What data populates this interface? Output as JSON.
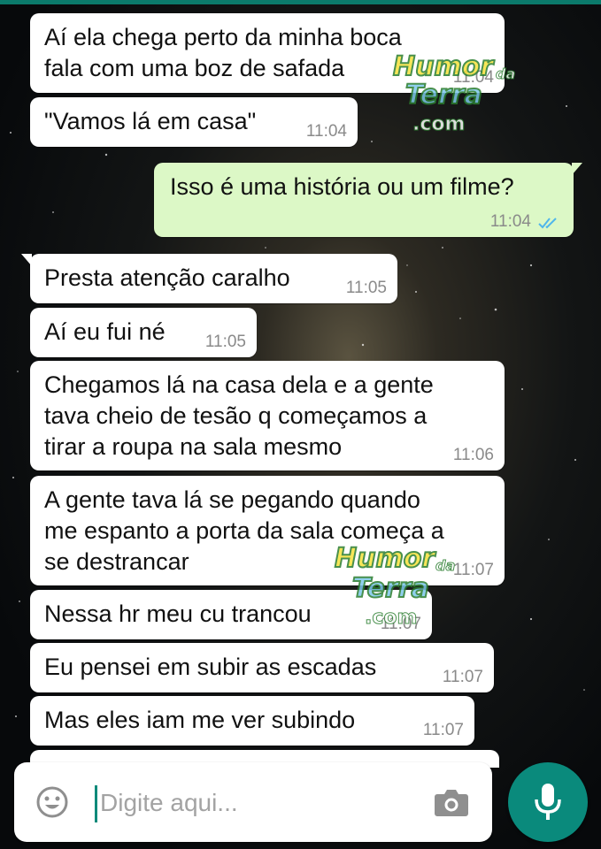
{
  "colors": {
    "header_accent": "#0b7a6b",
    "incoming_bubble": "#ffffff",
    "outgoing_bubble": "#dcf8c6",
    "read_ticks": "#4fb6ec",
    "mic_button": "#0a8a7c"
  },
  "messages": [
    {
      "direction": "incoming",
      "text": "Aí ela chega perto da minha boca\nfala com uma boz de safada",
      "time": "11:04"
    },
    {
      "direction": "incoming",
      "text": "\"Vamos lá em casa\"",
      "time": "11:04"
    },
    {
      "direction": "outgoing",
      "text": "Isso é uma história ou um filme?",
      "time": "11:04",
      "status": "read-double-check-icon"
    },
    {
      "direction": "incoming",
      "text": "Presta atenção caralho",
      "time": "11:05"
    },
    {
      "direction": "incoming",
      "text": "Aí eu fui né",
      "time": "11:05"
    },
    {
      "direction": "incoming",
      "text": "Chegamos lá na casa dela e a gente\ntava cheio de tesão q começamos a\ntirar a roupa na sala mesmo",
      "time": "11:06"
    },
    {
      "direction": "incoming",
      "text": "A gente tava lá se pegando quando\nme espanto a porta da sala começa a\nse destrancar",
      "time": "11:07"
    },
    {
      "direction": "incoming",
      "text": "Nessa hr meu cu trancou",
      "time": "11:07"
    },
    {
      "direction": "incoming",
      "text": "Eu pensei em subir as escadas",
      "time": "11:07"
    },
    {
      "direction": "incoming",
      "text": "Mas eles iam me ver subindo",
      "time": "11:07"
    }
  ],
  "input": {
    "placeholder": "Digite aqui...",
    "emoji_icon": "emoji-icon",
    "camera_icon": "camera-icon"
  },
  "mic_button": {
    "icon": "microphone-icon"
  },
  "watermark": {
    "line1": "Humor",
    "small": "da",
    "line2": "Terra",
    "line3": ".com"
  }
}
